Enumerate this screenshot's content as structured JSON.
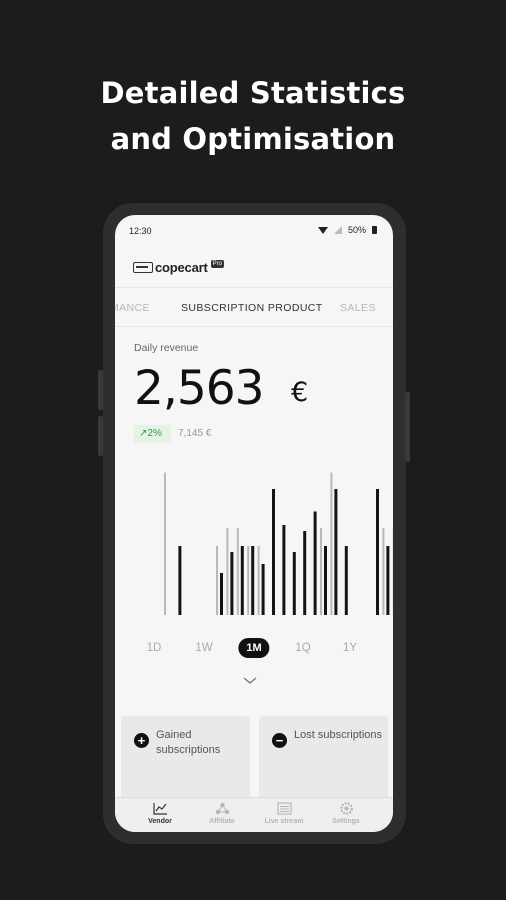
{
  "headline": {
    "line1": "Detailed Statistics",
    "line2": "and Optimisation"
  },
  "status_bar": {
    "time": "12:30",
    "battery": "50%"
  },
  "app": {
    "logo_text": "copecart",
    "logo_badge": "Pro"
  },
  "tabs": [
    "MANCE",
    "SUBSCRIPTION PRODUCT",
    "SALES"
  ],
  "active_tab": "SUBSCRIPTION PRODUCT",
  "revenue": {
    "label": "Daily revenue",
    "value": "2,563",
    "currency": "€",
    "change": "↗2%",
    "previous": "7,145 €"
  },
  "chart_data": {
    "type": "bar",
    "series": [
      {
        "values": [
          95,
          0,
          0,
          0,
          0,
          46,
          58,
          58,
          46,
          46,
          0,
          0,
          0,
          0,
          0,
          58,
          95,
          0,
          0,
          0,
          0,
          58,
          58,
          58,
          0
        ]
      },
      {
        "values": [
          0,
          46,
          0,
          0,
          0,
          28,
          42,
          46,
          46,
          34,
          84,
          60,
          42,
          56,
          69,
          46,
          84,
          46,
          0,
          0,
          84,
          46,
          36,
          42,
          44
        ]
      }
    ],
    "colors": [
      "#b9b9b9",
      "#141414"
    ]
  },
  "periods": [
    "1D",
    "1W",
    "1M",
    "1Q",
    "1Y"
  ],
  "active_period": "1M",
  "cards": [
    {
      "title": "Gained subscriptions",
      "icon": "plus-circle-icon"
    },
    {
      "title": "Lost subscriptions",
      "icon": "minus-circle-icon"
    }
  ],
  "bottom_nav": [
    {
      "label": "Vendor",
      "icon": "chart-line-icon"
    },
    {
      "label": "Affiliate",
      "icon": "network-icon"
    },
    {
      "label": "Live stream",
      "icon": "list-icon"
    },
    {
      "label": "Settings",
      "icon": "gear-icon"
    }
  ],
  "colors": {
    "background": "#1c1d1b",
    "accent_green": "#2f9a45",
    "ink": "#111111"
  }
}
